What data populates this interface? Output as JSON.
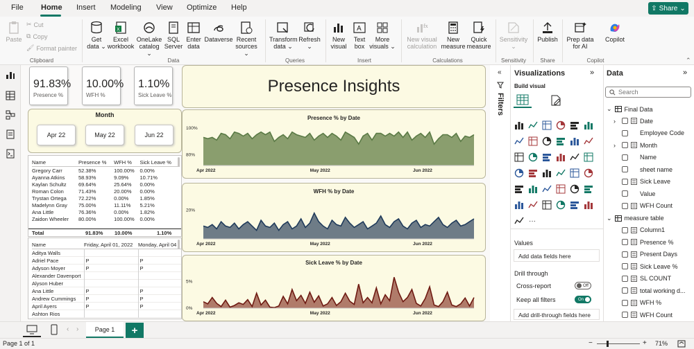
{
  "menu": {
    "file": "File",
    "home": "Home",
    "insert": "Insert",
    "modeling": "Modeling",
    "view": "View",
    "optimize": "Optimize",
    "help": "Help",
    "share": "Share"
  },
  "ribbon": {
    "clipboard": {
      "paste": "Paste",
      "cut": "Cut",
      "copy": "Copy",
      "format_painter": "Format painter",
      "group": "Clipboard"
    },
    "data": {
      "get_data": "Get data ⌄",
      "excel": "Excel workbook",
      "onelake": "OneLake catalog ⌄",
      "sql": "SQL Server",
      "enter": "Enter data",
      "dataverse": "Dataverse",
      "recent": "Recent sources ⌄",
      "group": "Data"
    },
    "queries": {
      "transform": "Transform data ⌄",
      "refresh": "Refresh ⌄",
      "group": "Queries"
    },
    "insert": {
      "new_visual": "New visual",
      "text_box": "Text box",
      "more_visuals": "More visuals ⌄",
      "group": "Insert"
    },
    "calculations": {
      "new_visual_calc": "New visual calculation",
      "new_measure": "New measure",
      "quick_measure": "Quick measure",
      "group": "Calculations"
    },
    "sensitivity": {
      "label": "Sensitivity ⌄",
      "group": "Sensitivity"
    },
    "share": {
      "publish": "Publish",
      "group": "Share"
    },
    "copilot": {
      "prep": "Prep data for AI",
      "copilot": "Copilot",
      "group": "Copilot"
    }
  },
  "report": {
    "title": "Presence Insights",
    "kpis": [
      {
        "value": "91.83%",
        "label": "Presence %"
      },
      {
        "value": "10.00%",
        "label": "WFH %"
      },
      {
        "value": "1.10%",
        "label": "Sick Leave %"
      }
    ],
    "month_slicer": {
      "title": "Month",
      "options": [
        "Apr 22",
        "May 22",
        "Jun 22"
      ]
    },
    "table1": {
      "headers": [
        "Name",
        "Presence %",
        "WFH %",
        "Sick Leave %"
      ],
      "rows": [
        [
          "Gregory Carr",
          "52.38%",
          "100.00%",
          "0.00%"
        ],
        [
          "Ayanna Atkins",
          "58.93%",
          "9.09%",
          "10.71%"
        ],
        [
          "Kaylan Schultz",
          "69.64%",
          "25.64%",
          "0.00%"
        ],
        [
          "Roman Colon",
          "71.43%",
          "20.00%",
          "0.00%"
        ],
        [
          "Trystan Ortega",
          "72.22%",
          "0.00%",
          "1.85%"
        ],
        [
          "Madelynn Gray",
          "75.00%",
          "11.11%",
          "5.21%"
        ],
        [
          "Ana Little",
          "76.36%",
          "0.00%",
          "1.82%"
        ],
        [
          "Zaidon Wheeler",
          "80.00%",
          "100.00%",
          "0.00%"
        ]
      ],
      "total": [
        "Total",
        "91.83%",
        "10.00%",
        "1.10%"
      ]
    },
    "table2": {
      "headers": [
        "Name",
        "Friday, April 01, 2022",
        "Monday, April 04"
      ],
      "rows": [
        [
          "Aditya Walls",
          "",
          ""
        ],
        [
          "Adriel Pace",
          "P",
          "P"
        ],
        [
          "Adyson Moyer",
          "P",
          "P"
        ],
        [
          "Alexander Davenport",
          "",
          ""
        ],
        [
          "Alyson Huber",
          "",
          ""
        ],
        [
          "Ana Little",
          "P",
          "P"
        ],
        [
          "Andrew Cummings",
          "P",
          "P"
        ],
        [
          "April Ayers",
          "P",
          "P"
        ],
        [
          "Ashton Rios",
          "",
          ""
        ]
      ]
    }
  },
  "chart_data": [
    {
      "type": "area",
      "title": "Presence % by Date",
      "yticks": [
        "100%",
        "80%"
      ],
      "xticks": [
        "Apr 2022",
        "May 2022",
        "Jun 2022"
      ],
      "ylim": [
        72,
        102
      ],
      "values": [
        93,
        92,
        93,
        91,
        96,
        95,
        92,
        97,
        96,
        94,
        96,
        92,
        95,
        97,
        95,
        97,
        90,
        93,
        95,
        92,
        97,
        95,
        94,
        93,
        96,
        91,
        94,
        96,
        93,
        96,
        94,
        91,
        97,
        95,
        93,
        88,
        94,
        96,
        91,
        96,
        96,
        94,
        96,
        94,
        97,
        93,
        97,
        91,
        94,
        96,
        93,
        97,
        88,
        92,
        95,
        95,
        93,
        96,
        90,
        94,
        93,
        95
      ],
      "color": "#8a9e6e",
      "line": "#5a7a45"
    },
    {
      "type": "area",
      "title": "WFH % by Date",
      "yticks": [
        "20%"
      ],
      "xticks": [
        "Apr 2022",
        "May 2022",
        "Jun 2022"
      ],
      "ylim": [
        0,
        28
      ],
      "values": [
        9,
        8,
        10,
        7,
        12,
        9,
        8,
        11,
        7,
        10,
        12,
        9,
        6,
        13,
        9,
        8,
        11,
        6,
        10,
        12,
        7,
        9,
        14,
        8,
        11,
        18,
        12,
        9,
        7,
        13,
        10,
        9,
        15,
        11,
        8,
        10,
        12,
        7,
        9,
        11,
        16,
        10,
        8,
        12,
        14,
        9,
        7,
        11,
        13,
        8,
        10,
        9,
        12,
        15,
        10,
        8,
        11,
        13,
        9,
        10,
        12,
        14
      ],
      "color": "#6e7c87",
      "line": "#1f3a5a"
    },
    {
      "type": "area",
      "title": "Sick Leave % by Date",
      "yticks": [
        "5%",
        "0%"
      ],
      "xticks": [
        "Apr 2022",
        "May 2022",
        "Jun 2022"
      ],
      "ylim": [
        0,
        7
      ],
      "values": [
        1.2,
        0.8,
        2.0,
        0.9,
        0.3,
        1.5,
        0.2,
        0.5,
        1.0,
        0.7,
        1.6,
        0.3,
        2.8,
        0.6,
        1.5,
        0.2,
        0.1,
        0.4,
        2.2,
        0.8,
        3.5,
        1.4,
        2.4,
        0.9,
        3.0,
        1.1,
        2.3,
        0.4,
        0.8,
        2.0,
        0.5,
        1.2,
        2.8,
        1.3,
        0.7,
        4.5,
        1.0,
        2.0,
        1.0,
        3.8,
        0.8,
        2.5,
        1.4,
        5.8,
        3.0,
        1.2,
        2.0,
        3.5,
        0.9,
        0.4,
        1.8,
        4.0,
        0.6,
        0.3,
        1.2,
        3.0,
        0.6,
        0.3,
        0.8,
        1.9,
        0.4,
        2.0
      ],
      "color": "#b07b6a",
      "line": "#6e1a12"
    }
  ],
  "filters": {
    "label": "Filters"
  },
  "visualizations": {
    "title": "Visualizations",
    "build_visual": "Build visual",
    "values": "Values",
    "add_data": "Add data fields here",
    "drill_through": "Drill through",
    "cross_report": "Cross-report",
    "cross_report_state": "Off",
    "keep_filters": "Keep all filters",
    "keep_filters_state": "On",
    "add_drill": "Add drill-through fields here"
  },
  "data_pane": {
    "title": "Data",
    "search_placeholder": "Search",
    "tables": [
      {
        "name": "Final Data",
        "fields": [
          "Date",
          "Employee Code",
          "Month",
          "Name",
          "sheet name",
          "Sick Leave",
          "Value",
          "WFH Count"
        ]
      },
      {
        "name": "measure table",
        "fields": [
          "Column1",
          "Presence %",
          "Present Days",
          "Sick Leave %",
          "SL COUNT",
          "total working d...",
          "WFH %",
          "WFH Count"
        ]
      }
    ]
  },
  "pages": {
    "tab": "Page 1",
    "add": "+"
  },
  "status": {
    "page": "Page 1 of 1",
    "zoom": "71%"
  }
}
